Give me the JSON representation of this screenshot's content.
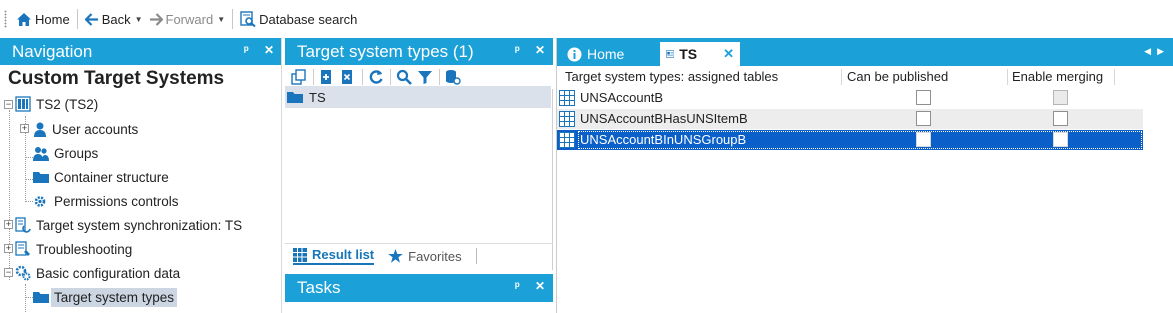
{
  "toolbar": {
    "home_label": "Home",
    "back_label": "Back",
    "forward_label": "Forward",
    "db_search_label": "Database search"
  },
  "navigation": {
    "header": "Navigation",
    "pin": "ᵖ",
    "close": "✕",
    "title": "Custom Target Systems",
    "items": [
      {
        "label": "TS2 (TS2)"
      },
      {
        "label": "User accounts"
      },
      {
        "label": "Groups"
      },
      {
        "label": "Container structure"
      },
      {
        "label": "Permissions controls"
      },
      {
        "label": "Target system synchronization: TS"
      },
      {
        "label": "Troubleshooting"
      },
      {
        "label": "Basic configuration data"
      },
      {
        "label": "Target system types"
      }
    ]
  },
  "result_panel": {
    "header": "Target system types (1)",
    "list": [
      {
        "label": "TS"
      }
    ],
    "tabs": [
      {
        "label": "Result list"
      },
      {
        "label": "Favorites"
      }
    ]
  },
  "tasks": {
    "header": "Tasks"
  },
  "document": {
    "tabs": [
      {
        "label": "Home"
      },
      {
        "label": "TS"
      }
    ],
    "close_symbol": "✕",
    "columns": [
      "Target system types: assigned tables",
      "Can be published",
      "Enable merging"
    ],
    "rows": [
      {
        "name": "UNSAccountB"
      },
      {
        "name": "UNSAccountBHasUNSItemB"
      },
      {
        "name": "UNSAccountBInUNSGroupB"
      }
    ]
  },
  "colors": {
    "accent": "#1ba1d8",
    "selection": "#0a5fc8",
    "tree_selection": "#ccd6e3"
  }
}
